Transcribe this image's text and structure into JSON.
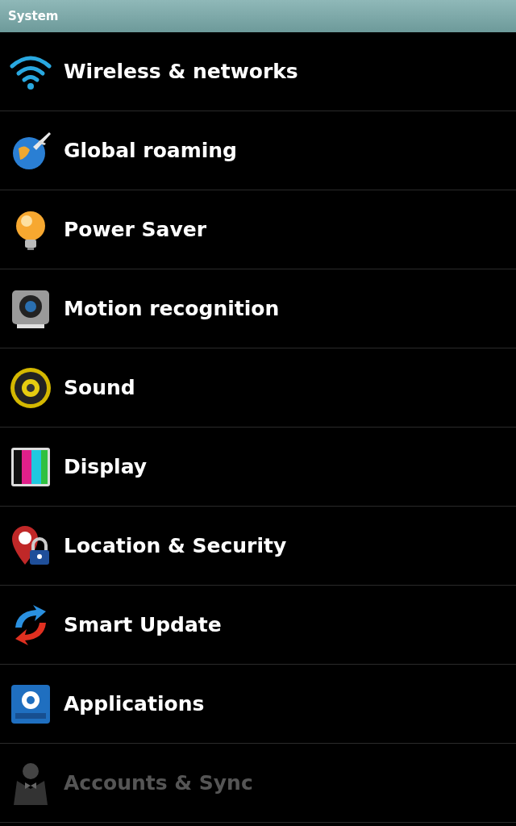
{
  "header": {
    "title": "System"
  },
  "items": [
    {
      "label": "Wireless & networks"
    },
    {
      "label": "Global roaming"
    },
    {
      "label": "Power Saver"
    },
    {
      "label": "Motion recognition"
    },
    {
      "label": "Sound"
    },
    {
      "label": "Display"
    },
    {
      "label": "Location & Security"
    },
    {
      "label": "Smart Update"
    },
    {
      "label": "Applications"
    },
    {
      "label": "Accounts & Sync",
      "disabled": true
    }
  ]
}
